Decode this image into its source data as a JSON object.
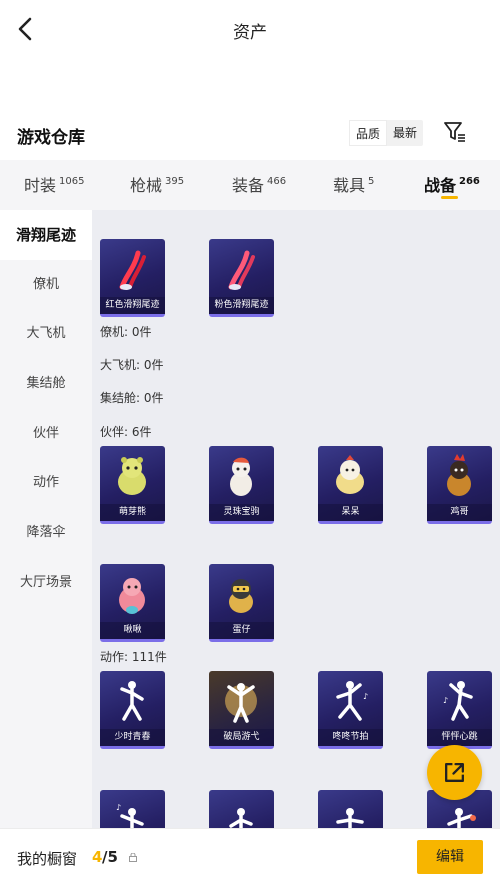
{
  "header": {
    "title": "资产"
  },
  "section": {
    "title": "游戏仓库"
  },
  "sort": {
    "quality": "品质",
    "newest": "最新"
  },
  "tabs": [
    {
      "label": "时装",
      "count": "1065"
    },
    {
      "label": "枪械",
      "count": "395"
    },
    {
      "label": "装备",
      "count": "466"
    },
    {
      "label": "载具",
      "count": "5"
    },
    {
      "label": "战备",
      "count": "266"
    }
  ],
  "sidebar": {
    "items": [
      "滑翔尾迹",
      "僚机",
      "大飞机",
      "集结舱",
      "伙伴",
      "动作",
      "降落伞",
      "大厅场景"
    ]
  },
  "content": {
    "glide_items": [
      "红色滑翔尾迹",
      "粉色滑翔尾迹"
    ],
    "wingman_label": "僚机: 0件",
    "plane_label": "大飞机: 0件",
    "pod_label": "集结舱: 0件",
    "partner_label": "伙伴: 6件",
    "partners": [
      "萌芽熊",
      "灵珠宝驹",
      "呆呆",
      "鸡哥",
      "啾啾",
      "蛋仔"
    ],
    "action_label": "动作: 111件",
    "actions": [
      "少时青春",
      "破局游弋",
      "咚咚节拍",
      "怦怦心跳"
    ]
  },
  "bottom": {
    "label": "我的橱窗",
    "count": "4",
    "total": "/5",
    "edit": "编辑"
  },
  "colors": {
    "accent": "#f7b500",
    "card_bg": "#2a2570",
    "card_border": "#7b6ee8"
  },
  "icons": {
    "back": "chevron-left-icon",
    "filter": "filter-icon",
    "share": "share-icon",
    "lock": "lock-icon"
  }
}
